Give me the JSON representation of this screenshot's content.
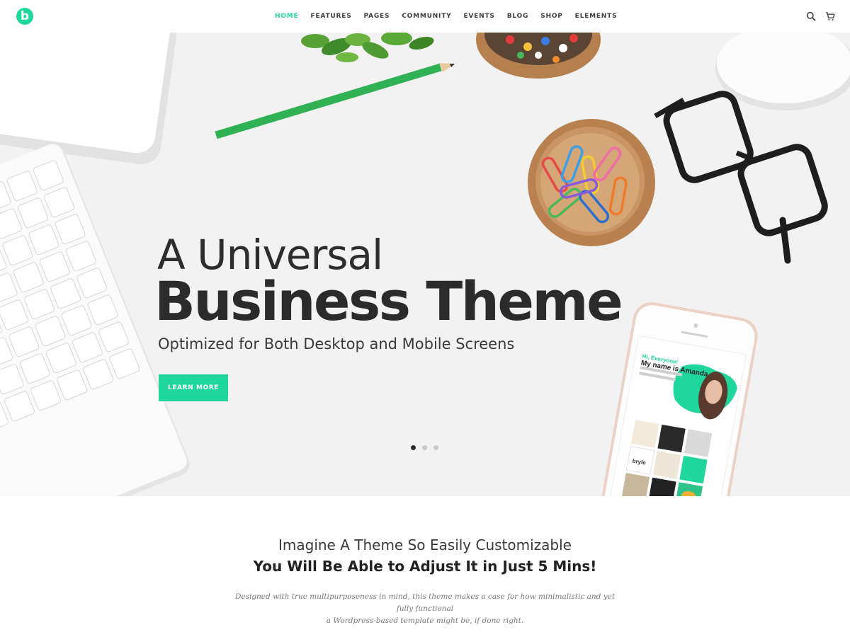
{
  "header": {
    "logo_letter": "b",
    "nav": [
      {
        "label": "HOME",
        "active": true
      },
      {
        "label": "FEATURES",
        "active": false
      },
      {
        "label": "PAGES",
        "active": false
      },
      {
        "label": "COMMUNITY",
        "active": false
      },
      {
        "label": "EVENTS",
        "active": false
      },
      {
        "label": "BLOG",
        "active": false
      },
      {
        "label": "SHOP",
        "active": false
      },
      {
        "label": "ELEMENTS",
        "active": false
      }
    ],
    "icons": [
      "search-icon",
      "cart-icon"
    ]
  },
  "hero": {
    "title_line1": "A Universal",
    "title_line2": "Business Theme",
    "subtitle": "Optimized for Both Desktop and Mobile Screens",
    "button_label": "LEARN MORE",
    "slider": {
      "count": 3,
      "active_index": 0
    },
    "phone_screen": {
      "greeting": "Hi, Everyone!",
      "headline": "My name is Amanda",
      "brand": "bryle"
    }
  },
  "intro": {
    "line1": "Imagine A Theme So Easily Customizable",
    "line2": "You Will Be Able to Adjust It in Just 5 Mins!",
    "paragraph_line1": "Designed with true multipurposeness in mind, this theme makes a case for how minimalistic and yet fully functional",
    "paragraph_line2": "a Wordpress-based template might be, if done right."
  },
  "colors": {
    "accent": "#1fd69c",
    "text_dark": "#2b2b2b",
    "hero_bg": "#f2f2f2"
  }
}
